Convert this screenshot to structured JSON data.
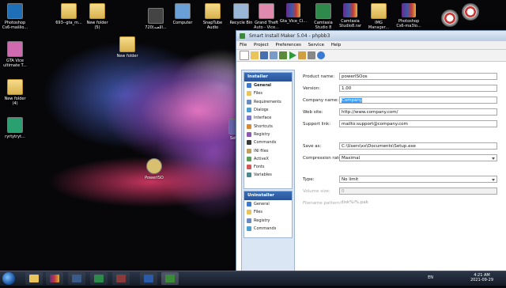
{
  "desktop": {
    "icons": [
      {
        "label": "Photoshop Cs6-mašlio...",
        "kind": "app",
        "color": "#1f6fb8"
      },
      {
        "label": "693--gta_m...",
        "kind": "folder"
      },
      {
        "label": "New folder (5)",
        "kind": "folder"
      },
      {
        "label": "720(اللعبه...",
        "kind": "app",
        "color": "#444"
      },
      {
        "label": "Computer",
        "kind": "app",
        "color": "#6aa0d8"
      },
      {
        "label": "SnapTube Audio",
        "kind": "folder"
      },
      {
        "label": "Recycle Bin",
        "kind": "app",
        "color": "#9ab7d8"
      },
      {
        "label": "Grand Theft Auto - Vice...",
        "kind": "app",
        "color": "#e08ab0"
      },
      {
        "label": "Gta_Vice_Ci...",
        "kind": "rar"
      },
      {
        "label": "Camtasia Studio 8",
        "kind": "app",
        "color": "#2e8a4a"
      },
      {
        "label": "Camtasia Studio8.rar",
        "kind": "rar"
      },
      {
        "label": "IMG Manager...",
        "kind": "folder"
      },
      {
        "label": "Photoshop Cs6-ma3lo...",
        "kind": "rar"
      },
      {
        "label": "New folder",
        "kind": "folder"
      },
      {
        "label": "GTA Vice ultimate T...",
        "kind": "app",
        "color": "#d06ab0"
      },
      {
        "label": "New folder (4)",
        "kind": "folder"
      },
      {
        "label": "ryrtytryt...",
        "kind": "app",
        "color": "#2aa070"
      },
      {
        "label": "PowerISO",
        "kind": "app",
        "color": "#d8c070"
      },
      {
        "label": "Setu...",
        "kind": "app",
        "color": "#66a"
      }
    ]
  },
  "window": {
    "title": "Smart Install Maker 5.04 - phpbb3",
    "menu": [
      "File",
      "Project",
      "Preferences",
      "Service",
      "Help"
    ],
    "sidebar": {
      "installer_title": "Installer",
      "installer_items": [
        "General",
        "Files",
        "Requirements",
        "Dialogs",
        "Interface",
        "Shortcuts",
        "Registry",
        "Commands",
        "INI files",
        "ActiveX",
        "Fonts",
        "Variables"
      ],
      "uninstaller_title": "Uninstaller",
      "uninstaller_items": [
        "General",
        "Files",
        "Registry",
        "Commands"
      ]
    },
    "form": {
      "product_name_label": "Product name:",
      "product_name": "powerISOos",
      "version_label": "Version:",
      "version": "1.00",
      "company_label": "Company name:",
      "company": "Company",
      "website_label": "Web site:",
      "website": "http://www.company.com/",
      "support_label": "Support link:",
      "support": "mailto:support@company.com",
      "saveas_label": "Save as:",
      "saveas": "C:\\Users\\xx\\Documents\\Setup.exe",
      "compression_label": "Compression rate:",
      "compression": "Maximal",
      "type_label": "Type:",
      "type": "No limit",
      "volume_label": "Volume size:",
      "volume": "0",
      "filename_label": "Filename pattern:",
      "filename": "disk%i%.pak"
    }
  },
  "taskbar": {
    "lang": "EN",
    "time": "4:21 AM",
    "date": "2021-09-29"
  }
}
